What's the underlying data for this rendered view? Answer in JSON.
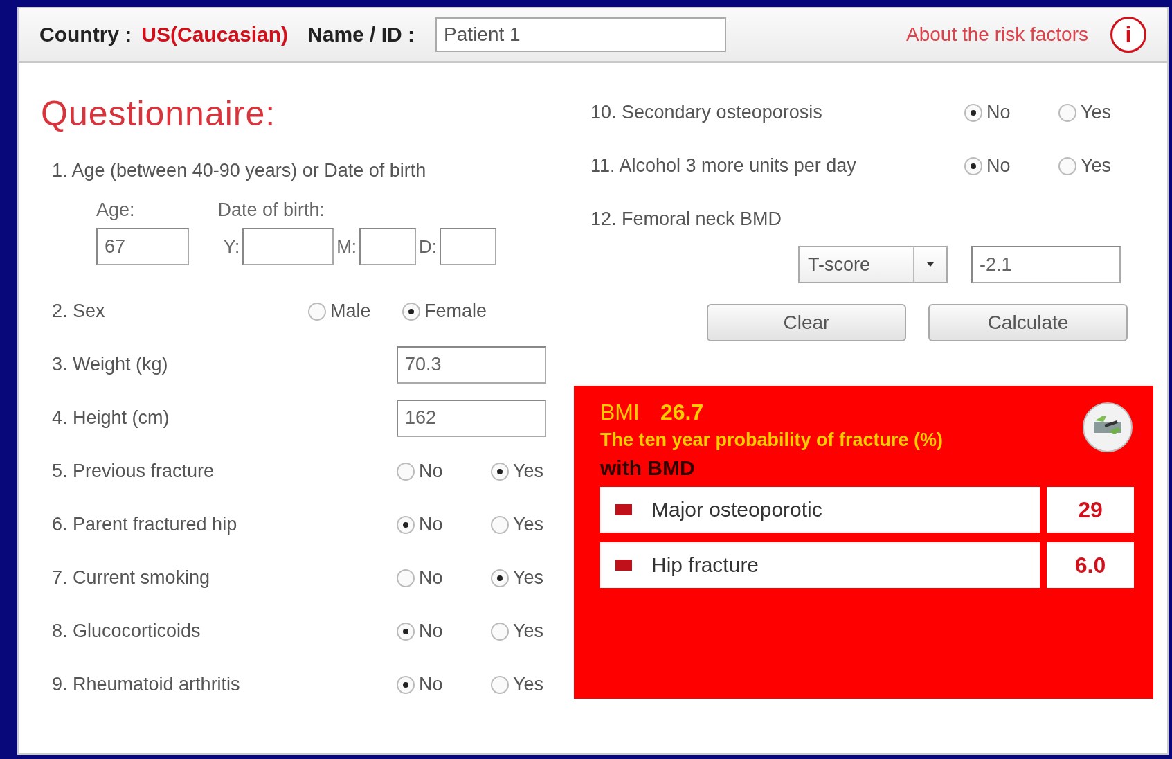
{
  "header": {
    "country_label": "Country :",
    "country": "US(Caucasian)",
    "name_label": "Name / ID :",
    "name_value": "Patient 1",
    "about_link": "About the risk factors",
    "info": "i"
  },
  "title": "Questionnaire:",
  "age_question": {
    "label": "1. Age (between 40-90 years) or Date of birth",
    "age_label": "Age:",
    "age_value": "67",
    "dob_label": "Date of birth:",
    "year_label": "Y:",
    "month_label": "M:",
    "day_label": "D:"
  },
  "left_questions": [
    {
      "kind": "radio",
      "label": "2. Sex",
      "options": [
        {
          "label": "Male",
          "selected": false
        },
        {
          "label": "Female",
          "selected": true
        }
      ]
    },
    {
      "kind": "input",
      "label": "3. Weight (kg)",
      "value": "70.3"
    },
    {
      "kind": "input",
      "label": "4. Height (cm)",
      "value": "162"
    },
    {
      "kind": "radio",
      "label": "5. Previous fracture",
      "options": [
        {
          "label": "No",
          "selected": false
        },
        {
          "label": "Yes",
          "selected": true
        }
      ]
    },
    {
      "kind": "radio",
      "label": "6. Parent fractured hip",
      "options": [
        {
          "label": "No",
          "selected": true
        },
        {
          "label": "Yes",
          "selected": false
        }
      ]
    },
    {
      "kind": "radio",
      "label": "7. Current smoking",
      "options": [
        {
          "label": "No",
          "selected": false
        },
        {
          "label": "Yes",
          "selected": true
        }
      ]
    },
    {
      "kind": "radio",
      "label": "8. Glucocorticoids",
      "options": [
        {
          "label": "No",
          "selected": true
        },
        {
          "label": "Yes",
          "selected": false
        }
      ]
    },
    {
      "kind": "radio",
      "label": "9. Rheumatoid arthritis",
      "options": [
        {
          "label": "No",
          "selected": true
        },
        {
          "label": "Yes",
          "selected": false
        }
      ]
    }
  ],
  "right_questions": [
    {
      "label": "10. Secondary osteoporosis",
      "options": [
        {
          "label": "No",
          "selected": true
        },
        {
          "label": "Yes",
          "selected": false
        }
      ]
    },
    {
      "label": "11. Alcohol 3 more units per day",
      "options": [
        {
          "label": "No",
          "selected": true
        },
        {
          "label": "Yes",
          "selected": false
        }
      ]
    }
  ],
  "bmd": {
    "label": "12. Femoral neck BMD",
    "score_type": "T-score",
    "value": "-2.1"
  },
  "buttons": [
    "Clear",
    "Calculate"
  ],
  "result": {
    "bmi_label": "BMI",
    "bmi_value": "26.7",
    "probability_title": "The ten year probability of fracture (%)",
    "section": "with BMD",
    "rows": [
      {
        "label": "Major osteoporotic",
        "value": "29"
      },
      {
        "label": "Hip fracture",
        "value": "6.0"
      }
    ]
  }
}
